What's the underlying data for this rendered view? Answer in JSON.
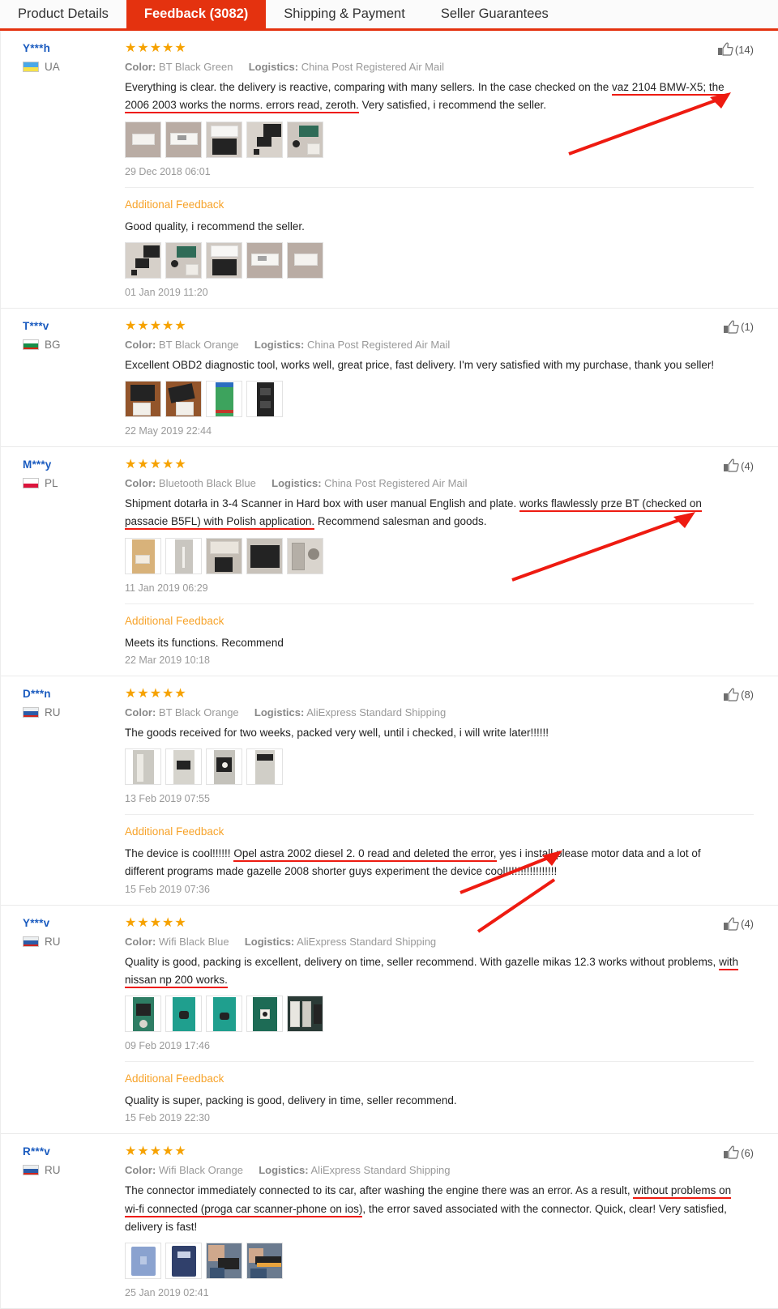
{
  "tabs": [
    {
      "label": "Product Details",
      "active": false
    },
    {
      "label": "Feedback (3082)",
      "active": true
    },
    {
      "label": "Shipping & Payment",
      "active": false
    },
    {
      "label": "Seller Guarantees",
      "active": false
    }
  ],
  "labels": {
    "color": "Color:",
    "logistics": "Logistics:",
    "additional_feedback": "Additional Feedback",
    "stars": "★★★★★"
  },
  "colors": {
    "accent_red": "#e4320f",
    "star_orange": "#f6a200",
    "username_blue": "#1a5bbf",
    "additional_feedback_orange": "#f7a32a",
    "highlight_underline": "#ee1b11"
  },
  "reviews": [
    {
      "username": "Y***h",
      "country": "UA",
      "flag": "ua",
      "stars": "★★★★★",
      "color": "BT Black Green",
      "logistics": "China Post Registered Air Mail",
      "likes": "(14)",
      "text_pre": "Everything is clear. the delivery is reactive, comparing with many sellers. In the case checked on the ",
      "text_hl": "vaz 2104 BMW-X5; the 2006 2003 works the norms. errors read, zeroth.",
      "text_post": " Very satisfied, i recommend the seller.",
      "photos": 5,
      "date": "29 Dec 2018 06:01",
      "additional": {
        "title": "Additional Feedback",
        "text": "Good quality, i recommend the seller.",
        "photos": 5,
        "date": "01 Jan 2019 11:20"
      }
    },
    {
      "username": "T***v",
      "country": "BG",
      "flag": "bg",
      "stars": "★★★★★",
      "color": "BT Black Orange",
      "logistics": "China Post Registered Air Mail",
      "likes": "(1)",
      "text_pre": "Excellent OBD2 diagnostic tool, works well, great price, fast delivery. I'm very satisfied with my purchase, thank you seller!",
      "text_hl": "",
      "text_post": "",
      "photos": 4,
      "date": "22 May 2019 22:44",
      "additional": null
    },
    {
      "username": "M***y",
      "country": "PL",
      "flag": "pl",
      "stars": "★★★★★",
      "color": "Bluetooth Black Blue",
      "logistics": "China Post Registered Air Mail",
      "likes": "(4)",
      "text_pre": "Shipment dotarła in 3-4 Scanner in Hard box with user manual English and plate. ",
      "text_hl": "works flawlessly prze BT (checked on passacie B5FL) with Polish application.",
      "text_post": " Recommend salesman and goods.",
      "photos": 5,
      "date": "11 Jan 2019 06:29",
      "additional": {
        "title": "Additional Feedback",
        "text": "Meets its functions. Recommend",
        "photos": 0,
        "date": "22 Mar 2019 10:18"
      }
    },
    {
      "username": "D***n",
      "country": "RU",
      "flag": "ru",
      "stars": "★★★★★",
      "color": "BT Black Orange",
      "logistics": "AliExpress Standard Shipping",
      "likes": "(8)",
      "text_pre": "The goods received for two weeks, packed very well, until i checked, i will write later!!!!!!",
      "text_hl": "",
      "text_post": "",
      "photos": 4,
      "date": "13 Feb 2019 07:55",
      "additional": {
        "title": "Additional Feedback",
        "text_pre": "The device is cool!!!!!! ",
        "text_hl": "Opel astra 2002 diesel 2. 0 read and deleted the error,",
        "text_post": " yes i install please motor data and a lot of different programs made gazelle 2008 shorter guys experiment the device cool!!!!!!!!!!!!!!!!!",
        "photos": 0,
        "date": "15 Feb 2019 07:36"
      }
    },
    {
      "username": "Y***v",
      "country": "RU",
      "flag": "ru",
      "stars": "★★★★★",
      "color": "Wifi Black Blue",
      "logistics": "AliExpress Standard Shipping",
      "likes": "(4)",
      "text_pre": "Quality is good, packing is excellent, delivery on time, seller recommend. With gazelle mikas 12.3 works without problems, ",
      "text_hl": "with nissan np 200 works.",
      "text_post": "",
      "photos": 5,
      "date": "09 Feb 2019 17:46",
      "additional": {
        "title": "Additional Feedback",
        "text": "Quality is super, packing is good, delivery in time, seller recommend.",
        "photos": 0,
        "date": "15 Feb 2019 22:30"
      }
    },
    {
      "username": "R***v",
      "country": "RU",
      "flag": "ru",
      "stars": "★★★★★",
      "color": "Wifi Black Orange",
      "logistics": "AliExpress Standard Shipping",
      "likes": "(6)",
      "text_pre": "The connector immediately connected to its car, after washing the engine there was an error. As a result, ",
      "text_hl": "without problems on wi-fi connected (proga car scanner-phone on ios)",
      "text_post": ", the error saved associated with the connector. Quick, clear! Very satisfied, delivery is fast!",
      "photos": 4,
      "date": "25 Jan 2019 02:41",
      "additional": null
    }
  ]
}
